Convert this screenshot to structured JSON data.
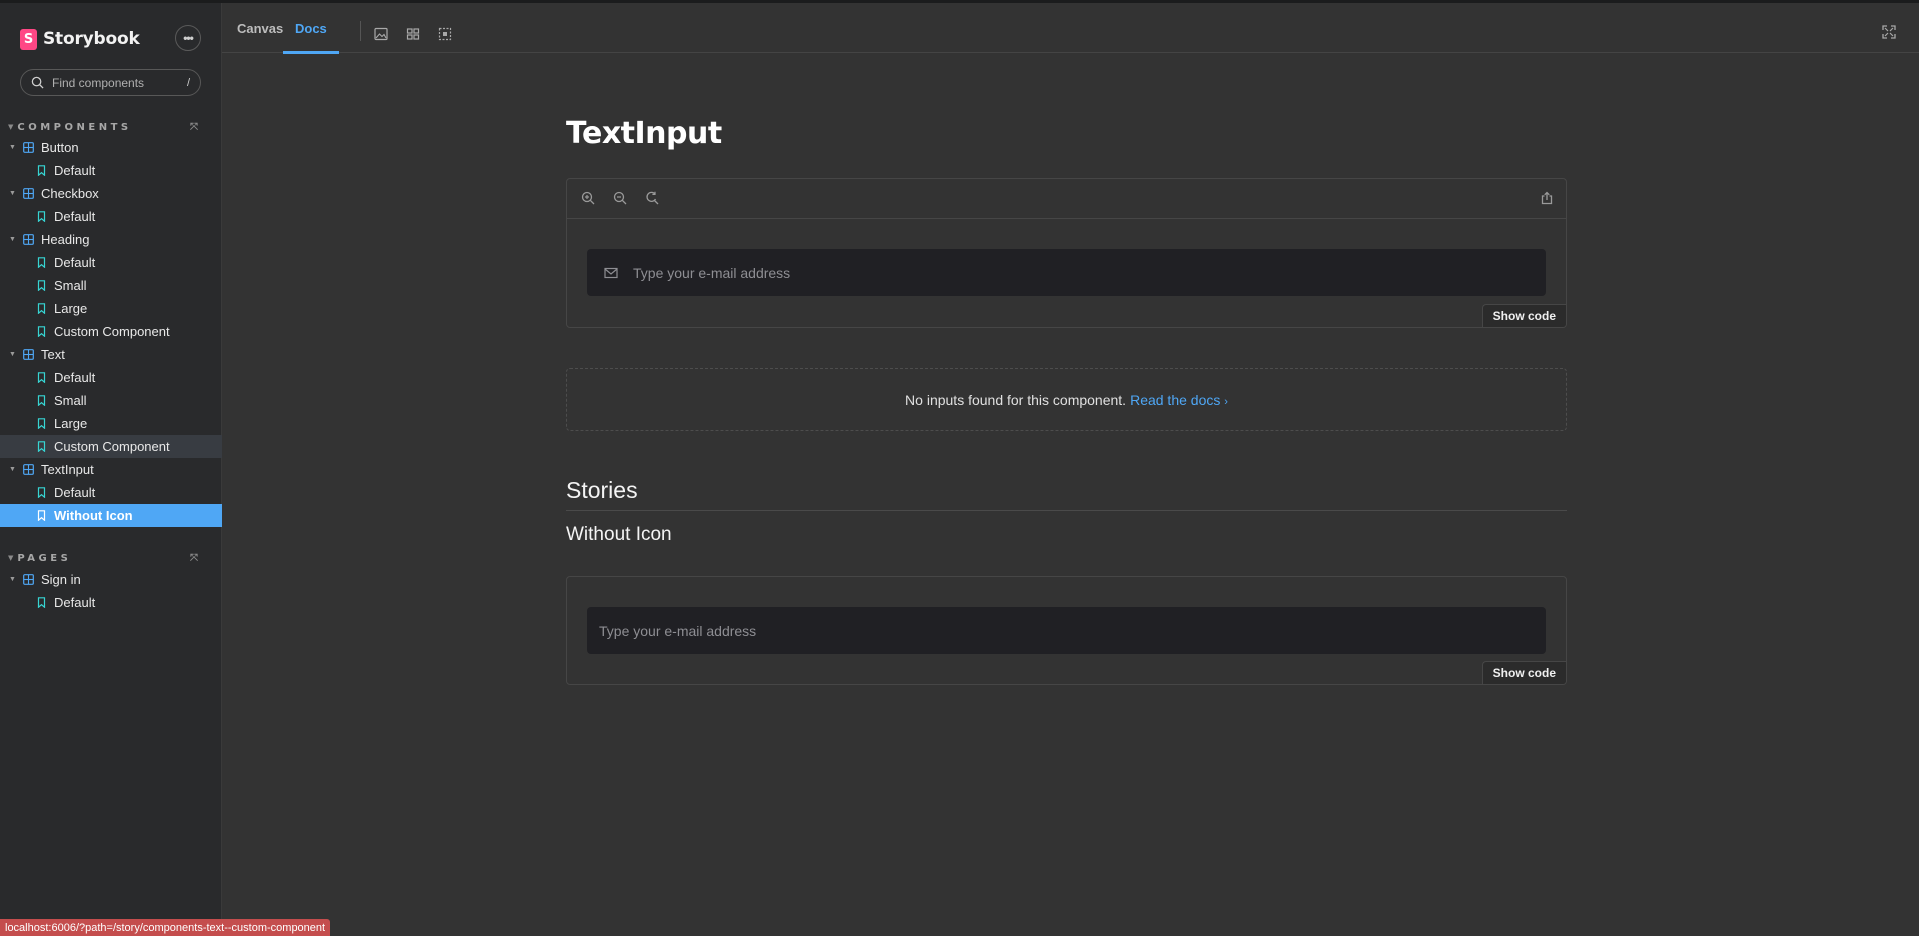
{
  "app": {
    "name": "Storybook",
    "logo_letter": "S"
  },
  "search": {
    "placeholder": "Find components",
    "shortcut": "/"
  },
  "sidebar": {
    "components_heading": "COMPONENTS",
    "pages_heading": "PAGES",
    "tree": [
      {
        "label": "Button",
        "kind": "component"
      },
      {
        "label": "Default",
        "kind": "story"
      },
      {
        "label": "Checkbox",
        "kind": "component"
      },
      {
        "label": "Default",
        "kind": "story"
      },
      {
        "label": "Heading",
        "kind": "component"
      },
      {
        "label": "Default",
        "kind": "story"
      },
      {
        "label": "Small",
        "kind": "story"
      },
      {
        "label": "Large",
        "kind": "story"
      },
      {
        "label": "Custom Component",
        "kind": "story"
      },
      {
        "label": "Text",
        "kind": "component"
      },
      {
        "label": "Default",
        "kind": "story"
      },
      {
        "label": "Small",
        "kind": "story"
      },
      {
        "label": "Large",
        "kind": "story"
      },
      {
        "label": "Custom Component",
        "kind": "story",
        "state": "hover"
      },
      {
        "label": "TextInput",
        "kind": "component"
      },
      {
        "label": "Default",
        "kind": "story"
      },
      {
        "label": "Without Icon",
        "kind": "story",
        "state": "selected"
      }
    ],
    "pages": [
      {
        "label": "Sign in",
        "kind": "component"
      },
      {
        "label": "Default",
        "kind": "story"
      }
    ]
  },
  "toolbar": {
    "tabs": [
      {
        "label": "Canvas",
        "active": false
      },
      {
        "label": "Docs",
        "active": true
      }
    ],
    "icons": [
      "image-icon",
      "grid-icon",
      "outline-icon"
    ],
    "fullscreen_icon": "fullscreen-icon"
  },
  "docs": {
    "title": "TextInput",
    "primary_preview": {
      "toolbar_icons": [
        "zoom-in-icon",
        "zoom-out-icon",
        "zoom-reset-icon",
        "share-icon"
      ],
      "input_placeholder": "Type your e-mail address",
      "input_icon": "mail-icon",
      "show_code_label": "Show code"
    },
    "args_table": {
      "message": "No inputs found for this component.",
      "link_label": "Read the docs",
      "link_icon": "chevron-right-icon"
    },
    "stories_heading": "Stories",
    "story": {
      "title": "Without Icon",
      "input_placeholder": "Type your e-mail address",
      "show_code_label": "Show code"
    }
  },
  "status_bar": {
    "url": "localhost:6006/?path=/story/components-text--custom-component"
  },
  "colors": {
    "accent": "#4fa7f5",
    "brand": "#ff4785",
    "background": "#333333",
    "sidebar": "#292a2c",
    "status": "#c44d4d"
  }
}
